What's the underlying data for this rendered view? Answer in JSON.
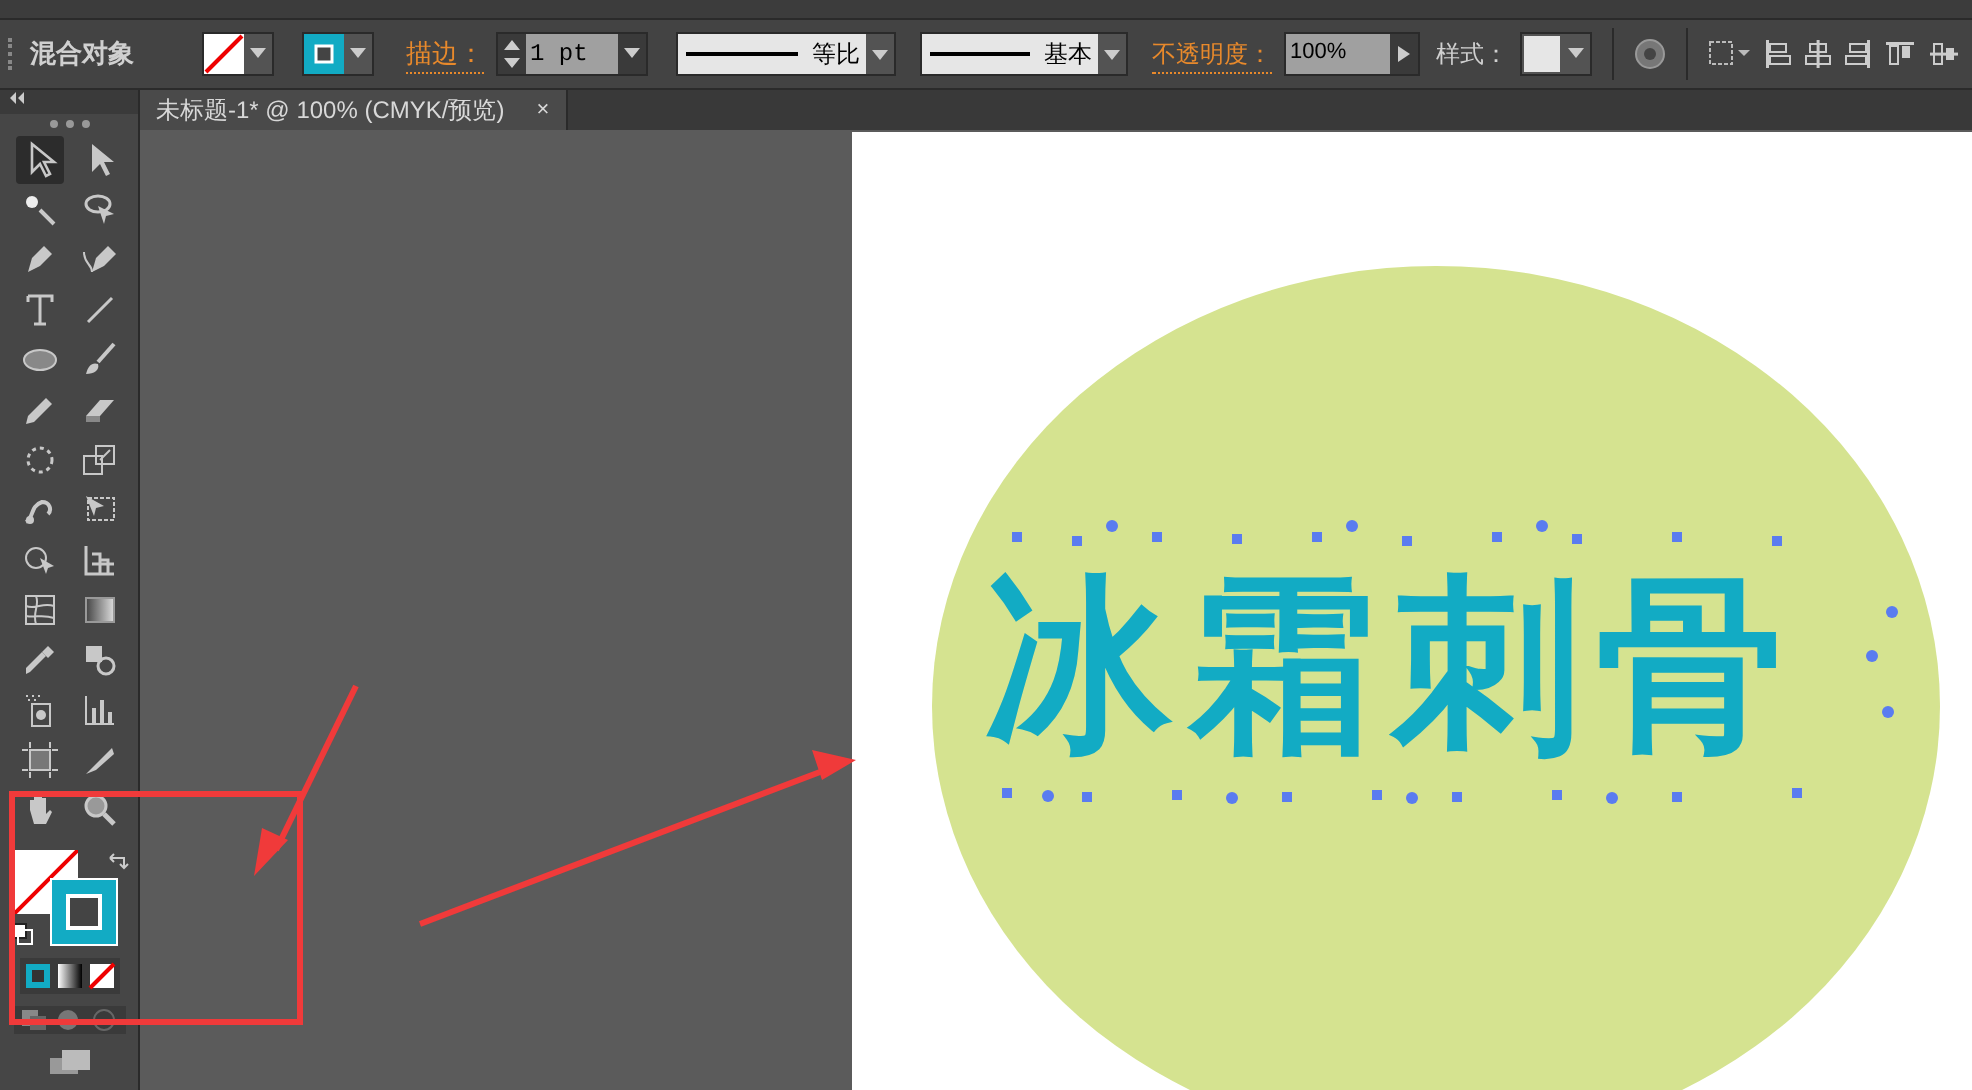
{
  "control_bar": {
    "selection_label": "混合对象",
    "stroke_label": "描边：",
    "stroke_weight": "1 pt",
    "variable_width": "等比",
    "brush": "基本",
    "opacity_label": "不透明度：",
    "opacity": "100%",
    "style_label": "样式："
  },
  "document_tab": {
    "title": "未标题-1* @ 100% (CMYK/预览)",
    "close": "×"
  },
  "toolbar": {
    "tools": [
      {
        "kind": "select",
        "selected": true
      },
      {
        "kind": "direct",
        "selected": false
      },
      {
        "kind": "wand",
        "selected": false
      },
      {
        "kind": "lasso",
        "selected": false
      },
      {
        "kind": "pen",
        "selected": false
      },
      {
        "kind": "pen2",
        "selected": false
      },
      {
        "kind": "type",
        "selected": false
      },
      {
        "kind": "line",
        "selected": false
      },
      {
        "kind": "ellipse",
        "selected": false
      },
      {
        "kind": "brush",
        "selected": false
      },
      {
        "kind": "pencil",
        "selected": false
      },
      {
        "kind": "eraser",
        "selected": false
      },
      {
        "kind": "rotate",
        "selected": false
      },
      {
        "kind": "scale",
        "selected": false
      },
      {
        "kind": "warp",
        "selected": false
      },
      {
        "kind": "freetransform",
        "selected": false
      },
      {
        "kind": "shapebuilder",
        "selected": false
      },
      {
        "kind": "graphgrid",
        "selected": false
      },
      {
        "kind": "mesh",
        "selected": false
      },
      {
        "kind": "gradient",
        "selected": false
      },
      {
        "kind": "eyedropper",
        "selected": false
      },
      {
        "kind": "blend",
        "selected": false
      },
      {
        "kind": "spray",
        "selected": false
      },
      {
        "kind": "graph",
        "selected": false
      },
      {
        "kind": "artboard",
        "selected": false
      },
      {
        "kind": "slice",
        "selected": false
      },
      {
        "kind": "hand",
        "selected": false
      },
      {
        "kind": "zoom",
        "selected": false
      }
    ]
  },
  "artwork": {
    "text": "冰霜刺骨"
  }
}
